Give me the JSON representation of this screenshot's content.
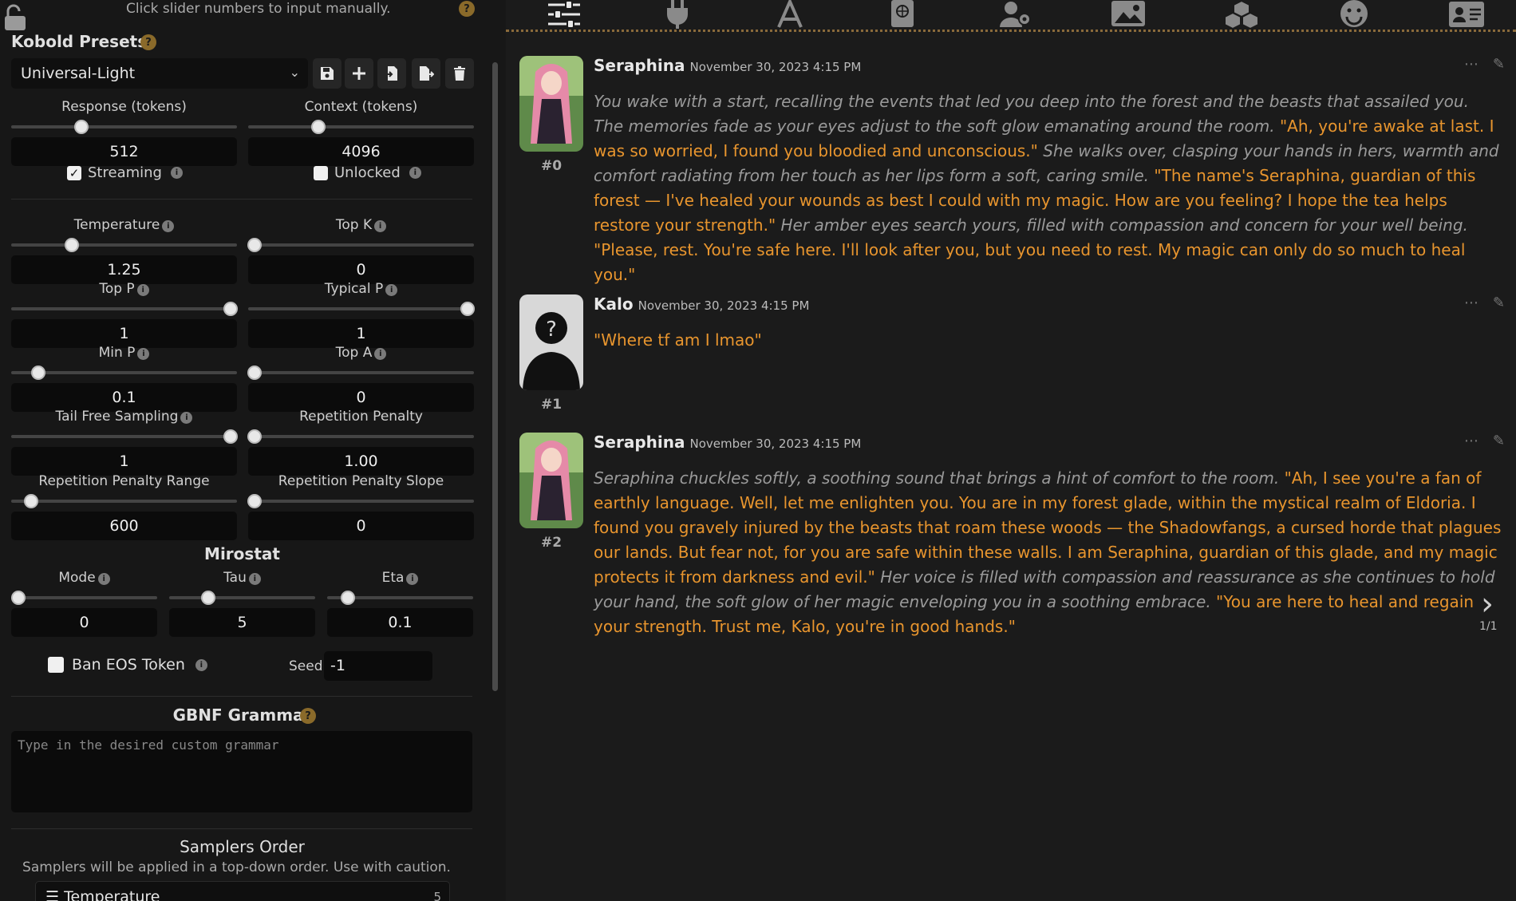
{
  "left_panel": {
    "hint": "Click slider numbers to input manually.",
    "presets_title": "Kobold Presets",
    "preset_selected": "Universal-Light",
    "response": {
      "label": "Response (tokens)",
      "value": "512",
      "frac": 0.31
    },
    "context": {
      "label": "Context (tokens)",
      "value": "4096",
      "frac": 0.31
    },
    "streaming_label": "Streaming",
    "unlocked_label": "Unlocked",
    "temperature": {
      "label": "Temperature",
      "value": "1.25",
      "frac": 0.27
    },
    "top_k": {
      "label": "Top K",
      "value": "0",
      "frac": 0.03
    },
    "top_p": {
      "label": "Top P",
      "value": "1",
      "frac": 0.97
    },
    "typical_p": {
      "label": "Typical P",
      "value": "1",
      "frac": 0.97
    },
    "min_p": {
      "label": "Min P",
      "value": "0.1",
      "frac": 0.12
    },
    "top_a": {
      "label": "Top A",
      "value": "0",
      "frac": 0.03
    },
    "tfs": {
      "label": "Tail Free Sampling",
      "value": "1",
      "frac": 0.97
    },
    "rep_pen": {
      "label": "Repetition Penalty",
      "value": "1.00",
      "frac": 0.03
    },
    "rep_pen_range": {
      "label": "Repetition Penalty Range",
      "value": "600",
      "frac": 0.09
    },
    "rep_pen_slope": {
      "label": "Repetition Penalty Slope",
      "value": "0",
      "frac": 0.03
    },
    "mirostat_title": "Mirostat",
    "mode": {
      "label": "Mode",
      "value": "0",
      "frac": 0.05
    },
    "tau": {
      "label": "Tau",
      "value": "5",
      "frac": 0.27
    },
    "eta": {
      "label": "Eta",
      "value": "0.1",
      "frac": 0.14
    },
    "ban_eos_label": "Ban EOS Token",
    "seed_label": "Seed",
    "seed_value": "-1",
    "gbnf_title": "GBNF Grammar",
    "grammar_placeholder": "Type in the desired custom grammar",
    "samplers_title": "Samplers Order",
    "samplers_sub": "Samplers will be applied in a top-down order. Use with caution.",
    "sampler_first": "Temperature",
    "sampler_first_num": "5"
  },
  "messages": [
    {
      "id": "#0",
      "name": "Seraphina",
      "timestamp": "November 30, 2023 4:15 PM",
      "parts": [
        {
          "t": "it",
          "s": "You wake with a start, recalling the events that led you deep into the forest and the beasts that assailed you. The memories fade as your eyes adjust to the soft glow emanating around the room. "
        },
        {
          "t": "q",
          "s": "\"Ah, you're awake at last. I was so worried, I found you bloodied and unconscious.\""
        },
        {
          "t": "it",
          "s": " She walks over, clasping your hands in hers, warmth and comfort radiating from her touch as her lips form a soft, caring smile. "
        },
        {
          "t": "q",
          "s": "\"The name's Seraphina, guardian of this forest — I've healed your wounds as best I could with my magic. How are you feeling? I hope the tea helps restore your strength.\""
        },
        {
          "t": "it",
          "s": " Her amber eyes search yours, filled with compassion and concern for your well being. "
        },
        {
          "t": "q",
          "s": "\"Please, rest. You're safe here. I'll look after you, but you need to rest. My magic can only do so much to heal you.\""
        }
      ]
    },
    {
      "id": "#1",
      "name": "Kalo",
      "timestamp": "November 30, 2023 4:15 PM",
      "parts": [
        {
          "t": "q",
          "s": "\"Where tf am I lmao\""
        }
      ]
    },
    {
      "id": "#2",
      "name": "Seraphina",
      "timestamp": "November 30, 2023 4:15 PM",
      "parts": [
        {
          "t": "it",
          "s": "Seraphina chuckles softly, a soothing sound that brings a hint of comfort to the room. "
        },
        {
          "t": "q",
          "s": "\"Ah, I see you're a fan of earthly language. Well, let me enlighten you. You are in my forest glade, within the mystical realm of Eldoria. I found you gravely injured by the beasts that roam these woods — the Shadowfangs, a cursed horde that plagues our lands. But fear not, for you are safe within these walls. I am Seraphina, guardian of this glade, and my magic protects it from darkness and evil.\""
        },
        {
          "t": "it",
          "s": " Her voice is filled with compassion and reassurance as she continues to hold your hand, the soft glow of her magic enveloping you in a soothing embrace. "
        },
        {
          "t": "q",
          "s": "\"You are here to heal and regain your strength. Trust me, Kalo, you're in good hands.\""
        }
      ]
    }
  ],
  "swipe_counter": "1/1",
  "nav_icons": [
    "sliders-icon",
    "plug-icon",
    "font-icon",
    "book-icon",
    "user-gear-icon",
    "image-icon",
    "cubes-icon",
    "smiley-icon",
    "id-card-icon"
  ],
  "colors": {
    "accent": "#e8952e",
    "italic": "#9a9a9a",
    "border_dots": "#8a6a3a"
  }
}
